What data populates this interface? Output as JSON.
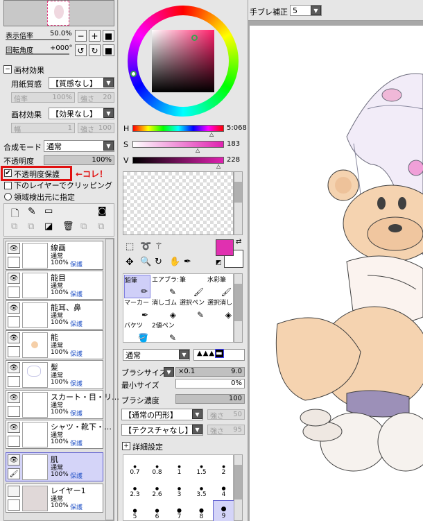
{
  "top_left": {
    "zoom_label": "表示倍率",
    "zoom_value": "50.0%",
    "rotate_label": "回転角度",
    "rotate_value": "+000°"
  },
  "paper": {
    "section_label": "画材効果",
    "texture_label": "用紙質感",
    "texture_value": "【質感なし】",
    "ratio_label": "倍率",
    "ratio_value": "100%",
    "strength_label": "強さ",
    "strength_value": "20",
    "effect_label": "画材効果",
    "effect_value": "【効果なし】",
    "width_label": "幅",
    "width_value": "1",
    "strength2_label": "強さ",
    "strength2_value": "100"
  },
  "blend": {
    "label": "合成モード",
    "value": "通常"
  },
  "opacity": {
    "label": "不透明度",
    "value": "100%"
  },
  "checks": {
    "protect": "不透明度保護",
    "annotation": "←コレ！",
    "clip": "下のレイヤーでクリッピング",
    "detect": "領域検出元に指定"
  },
  "layers": [
    {
      "name": "線画",
      "mode": "通常",
      "opacity": "100%",
      "prot": "保護"
    },
    {
      "name": "能目",
      "mode": "通常",
      "opacity": "100%",
      "prot": "保護"
    },
    {
      "name": "能耳、鼻",
      "mode": "通常",
      "opacity": "100%",
      "prot": "保護"
    },
    {
      "name": "能",
      "mode": "通常",
      "opacity": "100%",
      "prot": "保護"
    },
    {
      "name": "髪",
      "mode": "通常",
      "opacity": "100%",
      "prot": "保護"
    },
    {
      "name": "スカート・目・リ…",
      "mode": "通常",
      "opacity": "100%",
      "prot": "保護"
    },
    {
      "name": "シャツ・靴下・…",
      "mode": "通常",
      "opacity": "100%",
      "prot": "保護"
    },
    {
      "name": "肌",
      "mode": "通常",
      "opacity": "100%",
      "prot": "保護"
    },
    {
      "name": "レイヤー1",
      "mode": "通常",
      "opacity": "100%",
      "prot": "保護"
    }
  ],
  "hsv": {
    "h_label": "H",
    "h_value": "5:068",
    "s_label": "S",
    "s_value": "183",
    "v_label": "V",
    "v_value": "228"
  },
  "colors": {
    "primary": "#e030b0",
    "secondary": "#ffffff"
  },
  "tools": [
    {
      "name": "鉛筆"
    },
    {
      "name": "エアブラシ"
    },
    {
      "name": "筆"
    },
    {
      "name": "水彩筆"
    },
    {
      "name": "マーカー"
    },
    {
      "name": "消しゴム"
    },
    {
      "name": "選択ペン"
    },
    {
      "name": "選択消し"
    },
    {
      "name": "バケツ"
    },
    {
      "name": "2値ペン"
    }
  ],
  "brush": {
    "mode_value": "通常",
    "size_label": "ブラシサイズ",
    "size_mult": "×0.1",
    "size_value": "9.0",
    "min_label": "最小サイズ",
    "min_value": "0%",
    "density_label": "ブラシ濃度",
    "density_value": "100",
    "shape_value": "【通常の円形】",
    "shape_strength_label": "強さ",
    "shape_strength_value": "50",
    "texture_value": "【テクスチャなし】",
    "tex_strength_label": "強さ",
    "tex_strength_value": "95",
    "detail_label": "詳細設定"
  },
  "size_presets": [
    "0.7",
    "0.8",
    "1",
    "1.5",
    "2",
    "2.3",
    "2.6",
    "3",
    "3.5",
    "4",
    "5",
    "6",
    "7",
    "8",
    "9"
  ],
  "toolbar": {
    "stabilizer_label": "手ブレ補正",
    "stabilizer_value": "5"
  }
}
